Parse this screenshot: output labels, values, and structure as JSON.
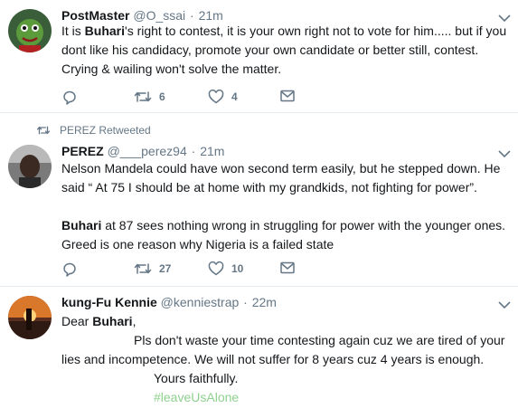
{
  "tweets": [
    {
      "name": "PostMaster",
      "handle": "@O_ssai",
      "time": "21m",
      "text_parts": [
        {
          "t": "It is "
        },
        {
          "b": "Buhari"
        },
        {
          "t": "'s right to contest, it is your own right not to vote for him..... but if you dont like his candidacy, promote your own candidate or better still, contest. Crying & wailing won't solve the matter."
        }
      ],
      "replies": "",
      "retweets": "6",
      "likes": "4"
    },
    {
      "retweeted_by": "PEREZ Retweeted",
      "name": "PEREZ",
      "handle": "@___perez94",
      "time": "21m",
      "para1": "Nelson Mandela could have won second term easily, but he stepped down. He said “ At 75 I should be at home with my grandkids, not fighting for power”.",
      "para2_bold": "Buhari",
      "para2_rest": " at 87 sees nothing wrong in struggling for power with the younger ones. Greed is one reason why Nigeria is a failed state",
      "replies": "",
      "retweets": "27",
      "likes": "10"
    },
    {
      "name": "kung-Fu Kennie",
      "handle": "@kenniestrap",
      "time": "22m",
      "greeting_prefix": "Dear ",
      "greeting_bold": "Buhari",
      "greeting_suffix": ",",
      "body_line1": "Pls don't waste your time contesting again cuz we are tired of your",
      "body_line2": "lies and incompetence. We will not suffer for 8 years cuz 4 years is enough.",
      "signoff": "Yours faithfully.",
      "hashtag": "#leaveUsAlone"
    }
  ],
  "icons": {
    "reply": "reply-icon",
    "retweet": "retweet-icon",
    "like": "heart-icon",
    "message": "envelope-icon",
    "caret": "chevron-down-icon"
  },
  "colors": {
    "text": "#14171a",
    "muted": "#657786",
    "divider": "#e6ecf0",
    "hashtag": "#8fd18f"
  }
}
